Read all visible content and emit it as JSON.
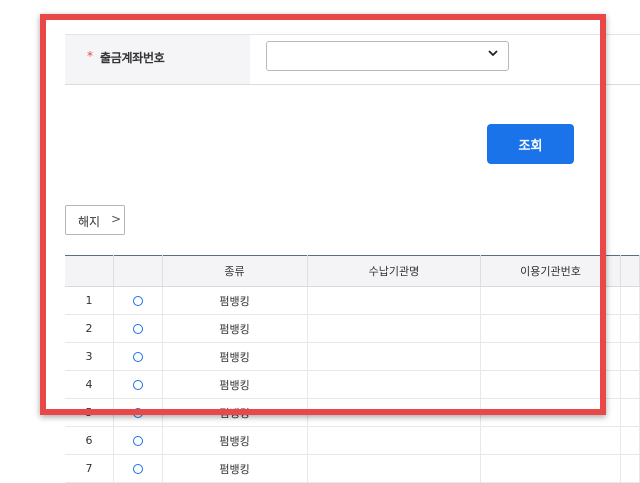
{
  "form": {
    "required_mark": "*",
    "account_label": "출금계좌번호",
    "account_value": ""
  },
  "query_button": "조회",
  "cancel_button": {
    "label": "해지",
    "arrow": ">"
  },
  "table": {
    "headers": [
      "",
      "",
      "종류",
      "수납기관명",
      "이용기관번호",
      ""
    ],
    "rows": [
      {
        "no": "1",
        "type": "펌뱅킹"
      },
      {
        "no": "2",
        "type": "펌뱅킹"
      },
      {
        "no": "3",
        "type": "펌뱅킹"
      },
      {
        "no": "4",
        "type": "펌뱅킹"
      },
      {
        "no": "5",
        "type": "펌뱅킹"
      },
      {
        "no": "6",
        "type": "펌뱅킹"
      },
      {
        "no": "7",
        "type": "펌뱅킹"
      }
    ]
  },
  "colors": {
    "primary": "#1a73e8",
    "highlight": "#e84848",
    "required": "#e54848"
  },
  "icons": {
    "select": "chevron-down-icon",
    "cancel": "chevron-right-icon",
    "row_select": "radio-icon"
  }
}
